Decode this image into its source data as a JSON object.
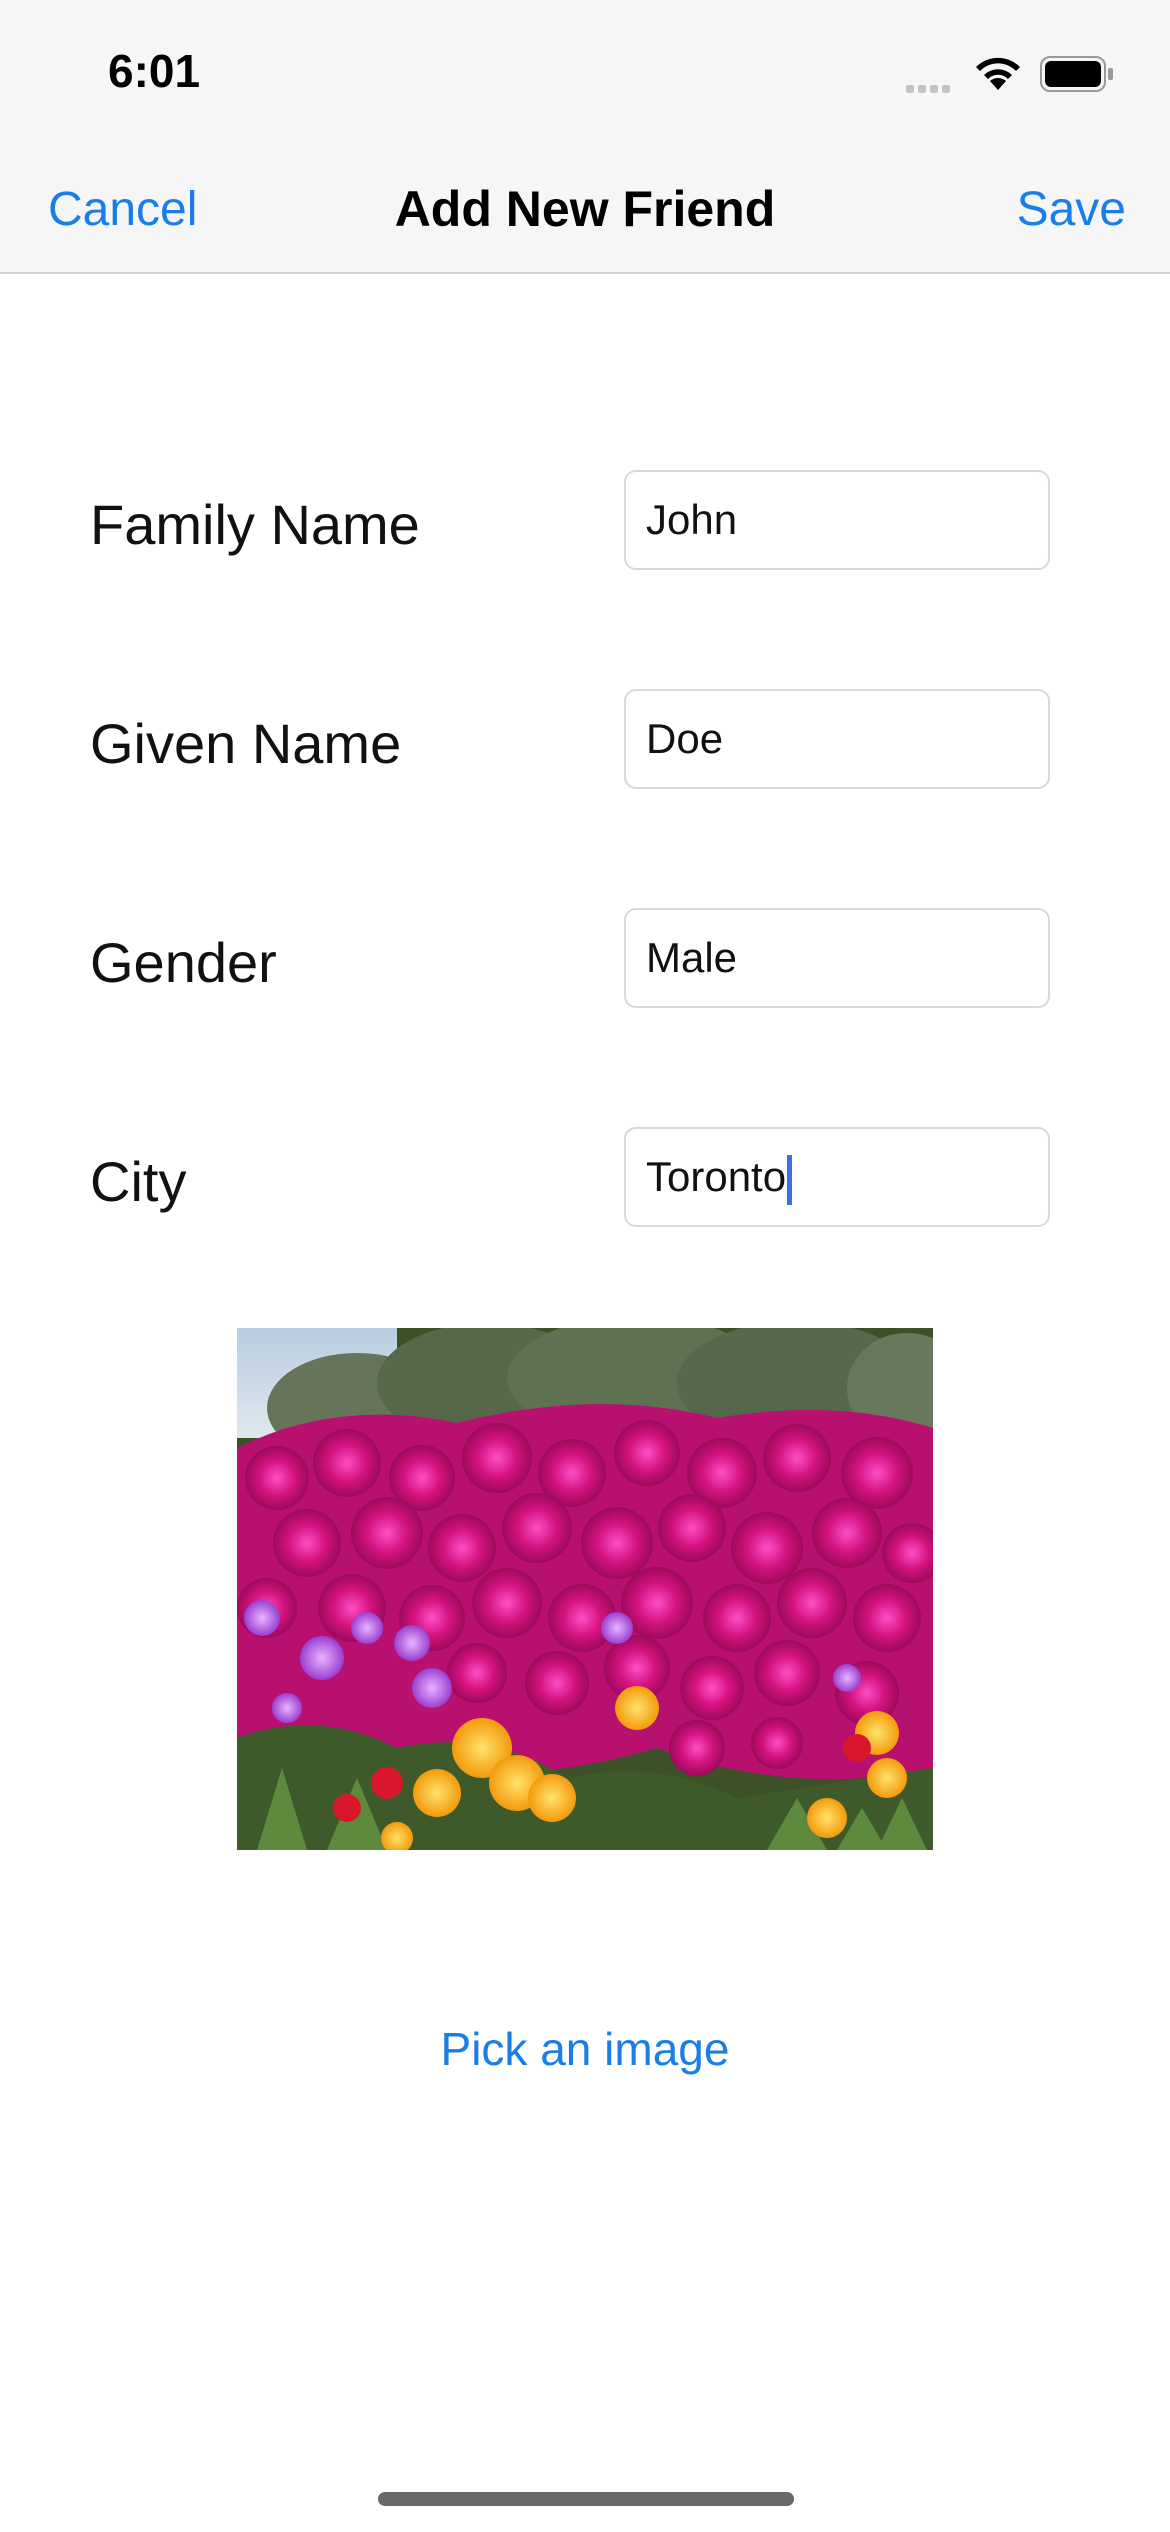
{
  "status_bar": {
    "time": "6:01",
    "icons": [
      "cellular-signal-icon",
      "wifi-icon",
      "battery-icon"
    ]
  },
  "nav": {
    "cancel_label": "Cancel",
    "title": "Add New Friend",
    "save_label": "Save"
  },
  "form": {
    "fields": [
      {
        "label": "Family Name",
        "value": "John"
      },
      {
        "label": "Given Name",
        "value": "Doe"
      },
      {
        "label": "Gender",
        "value": "Male"
      },
      {
        "label": "City",
        "value": "Toronto",
        "focused": true
      }
    ]
  },
  "photo": {
    "subject": "photo of magenta, purple and yellow ice plant flowers"
  },
  "pick_image_label": "Pick an image",
  "colors": {
    "accent": "#1a7ee8",
    "bar_background": "#f6f6f6",
    "caret": "#3f6fe6"
  }
}
